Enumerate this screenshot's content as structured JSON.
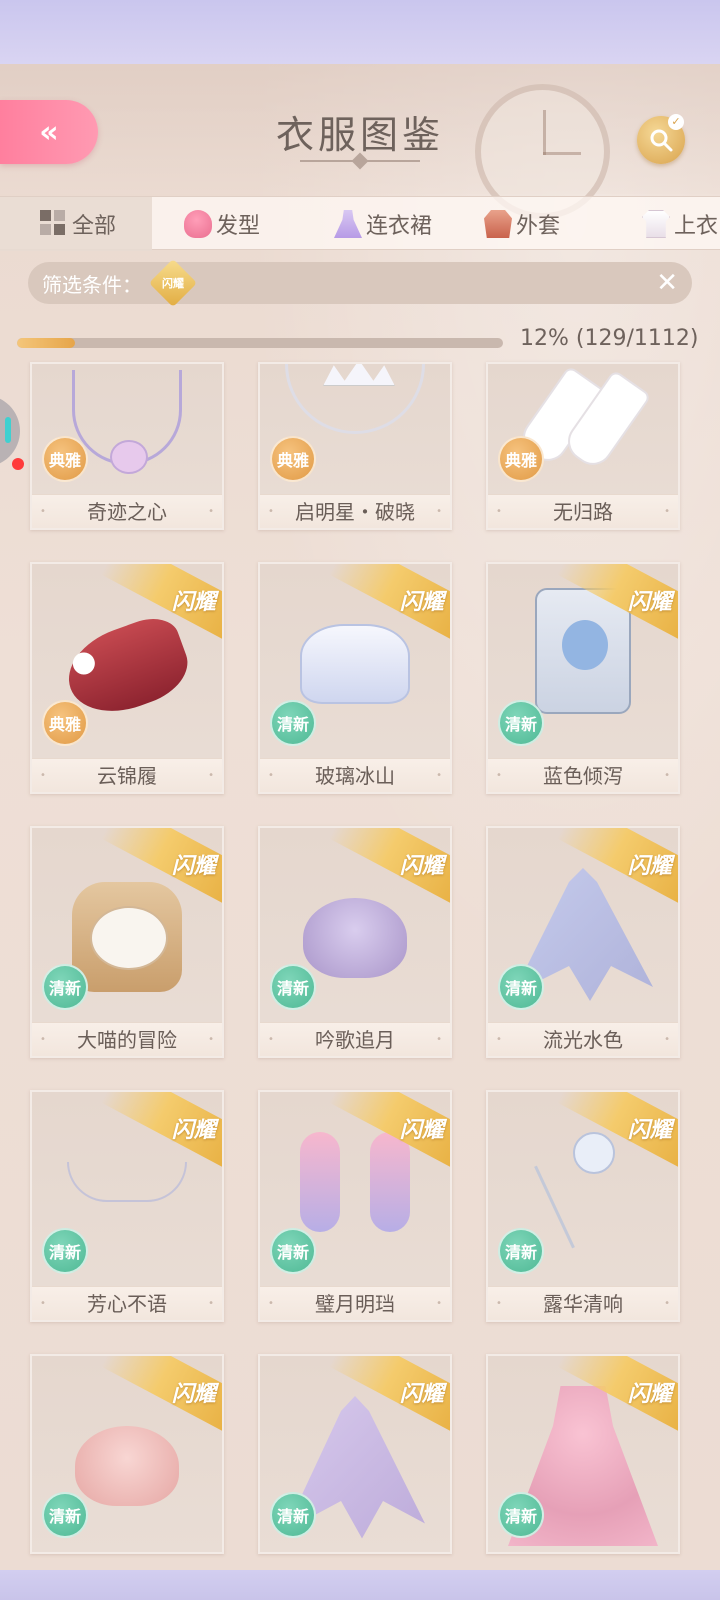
{
  "header": {
    "title": "衣服图鉴",
    "back_icon": "double-chevron-left-icon",
    "search_icon": "search-check-icon"
  },
  "tabs": [
    {
      "label": "全部",
      "icon": "grid-icon",
      "active": true
    },
    {
      "label": "发型",
      "icon": "hairstyle-icon"
    },
    {
      "label": "连衣裙",
      "icon": "dress-icon"
    },
    {
      "label": "外套",
      "icon": "coat-icon"
    },
    {
      "label": "上衣",
      "icon": "top-icon"
    }
  ],
  "filter": {
    "label": "筛选条件：",
    "tag": "闪耀",
    "clear_icon": "close-icon"
  },
  "progress": {
    "percent": 12,
    "text": "12% (129/1112)"
  },
  "items": [
    {
      "name": "奇迹之心",
      "badge": "典雅",
      "ribbon": ""
    },
    {
      "name": "启明星・破晓",
      "badge": "典雅",
      "ribbon": ""
    },
    {
      "name": "无归路",
      "badge": "典雅",
      "ribbon": ""
    },
    {
      "name": "云锦履",
      "badge": "典雅",
      "ribbon": "闪耀"
    },
    {
      "name": "玻璃冰山",
      "badge": "清新",
      "ribbon": "闪耀"
    },
    {
      "name": "蓝色倾泻",
      "badge": "清新",
      "ribbon": "闪耀"
    },
    {
      "name": "大喵的冒险",
      "badge": "清新",
      "ribbon": "闪耀"
    },
    {
      "name": "吟歌追月",
      "badge": "清新",
      "ribbon": "闪耀"
    },
    {
      "name": "流光水色",
      "badge": "清新",
      "ribbon": "闪耀"
    },
    {
      "name": "芳心不语",
      "badge": "清新",
      "ribbon": "闪耀"
    },
    {
      "name": "璧月明珰",
      "badge": "清新",
      "ribbon": "闪耀"
    },
    {
      "name": "露华清响",
      "badge": "清新",
      "ribbon": "闪耀"
    },
    {
      "name": "",
      "badge": "清新",
      "ribbon": "闪耀"
    },
    {
      "name": "",
      "badge": "清新",
      "ribbon": "闪耀"
    },
    {
      "name": "",
      "badge": "清新",
      "ribbon": "闪耀"
    }
  ],
  "colors": {
    "accent_pink": "#ff8aa8",
    "gold": "#e6a54a",
    "elegant_badge": "#e19a45",
    "fresh_badge": "#4fb995",
    "text": "#6e625c"
  }
}
